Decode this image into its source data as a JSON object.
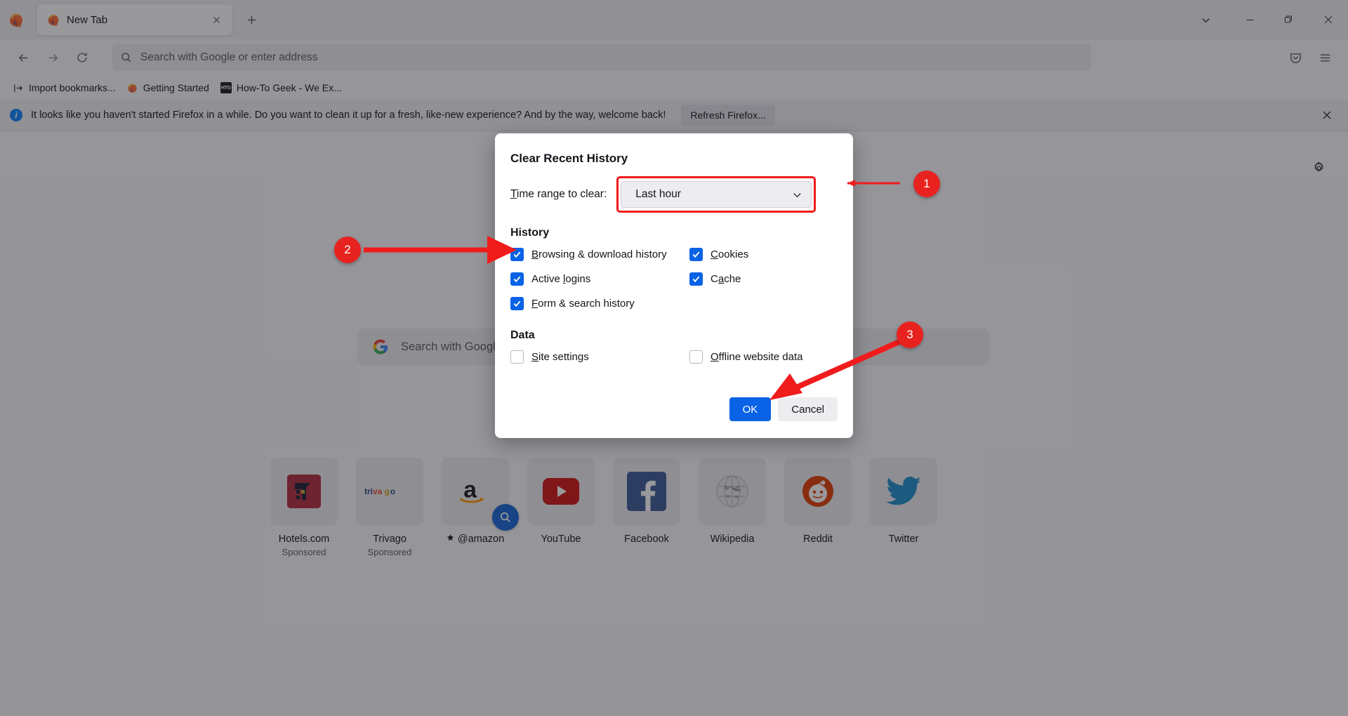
{
  "window": {
    "app": "Firefox",
    "tab": {
      "title": "New Tab",
      "favicon": "firefox-icon"
    },
    "new_tab_button": "+",
    "controls": {
      "list_all_tabs": "chevron-down-icon",
      "minimize": "minimize-icon",
      "maximize": "maximize-icon",
      "close": "close-icon"
    }
  },
  "navbar": {
    "back": "back-arrow-icon",
    "forward": "forward-arrow-icon",
    "reload": "reload-icon",
    "urlbar_placeholder": "Search with Google or enter address",
    "search_icon": "search-icon",
    "pocket": "pocket-icon",
    "menu": "hamburger-menu-icon"
  },
  "bookmarks": [
    {
      "label": "Import bookmarks...",
      "icon": "import-icon"
    },
    {
      "label": "Getting Started",
      "icon": "firefox-icon"
    },
    {
      "label": "How-To Geek - We Ex...",
      "icon": "htg-icon"
    }
  ],
  "notification": {
    "icon": "info-icon",
    "message": "It looks like you haven't started Firefox in a while. Do you want to clean it up for a fresh, like-new experience? And by the way, welcome back!",
    "button": "Refresh Firefox...",
    "close": "close-icon"
  },
  "newtab": {
    "settings_icon": "gear-icon",
    "search": {
      "placeholder": "Search with Google or enter address",
      "engine_icon": "google-icon"
    },
    "tiles": [
      {
        "label": "Hotels.com",
        "sublabel": "Sponsored",
        "icon": "hotels-icon"
      },
      {
        "label": "Trivago",
        "sublabel": "Sponsored",
        "icon": "trivago-icon"
      },
      {
        "label": "@amazon",
        "sublabel": "",
        "icon": "amazon-icon",
        "pin": true,
        "badge": "search-icon"
      },
      {
        "label": "YouTube",
        "sublabel": "",
        "icon": "youtube-icon"
      },
      {
        "label": "Facebook",
        "sublabel": "",
        "icon": "facebook-icon"
      },
      {
        "label": "Wikipedia",
        "sublabel": "",
        "icon": "wikipedia-icon"
      },
      {
        "label": "Reddit",
        "sublabel": "",
        "icon": "reddit-icon"
      },
      {
        "label": "Twitter",
        "sublabel": "",
        "icon": "twitter-icon"
      }
    ]
  },
  "dialog": {
    "title": "Clear Recent History",
    "time_range_label": "Time range to clear:",
    "time_range_label_accesskey": "T",
    "time_range_value": "Last hour",
    "dropdown_icon": "chevron-down-icon",
    "history_section": "History",
    "data_section": "Data",
    "history_items": [
      {
        "label": "Browsing & download history",
        "accesskey": "B",
        "checked": true,
        "column": "left"
      },
      {
        "label": "Cookies",
        "accesskey": "C",
        "checked": true,
        "column": "right"
      },
      {
        "label": "Active logins",
        "accesskey": "l",
        "checked": true,
        "column": "left"
      },
      {
        "label": "Cache",
        "accesskey": "a",
        "checked": true,
        "column": "right"
      },
      {
        "label": "Form & search history",
        "accesskey": "F",
        "checked": true,
        "column": "left"
      }
    ],
    "data_items": [
      {
        "label": "Site settings",
        "accesskey": "S",
        "checked": false,
        "column": "left"
      },
      {
        "label": "Offline website data",
        "accesskey": "O",
        "checked": false,
        "column": "right"
      }
    ],
    "ok_button": "OK",
    "cancel_button": "Cancel"
  },
  "annotations": {
    "markers": [
      {
        "number": "1",
        "target": "time-range-dropdown"
      },
      {
        "number": "2",
        "target": "browsing-download-history-checkbox"
      },
      {
        "number": "3",
        "target": "ok-button"
      }
    ],
    "color": "#e8231f"
  },
  "colors": {
    "accent": "#0a62e6",
    "annotation_red": "#e8231f",
    "chrome_bg": "#f9f9fb",
    "tab_bg": "#f0f0f4"
  }
}
